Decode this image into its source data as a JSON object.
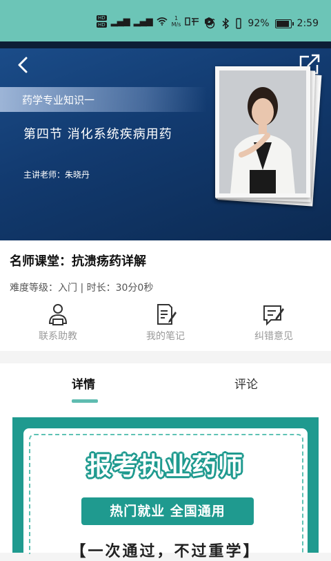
{
  "status_bar": {
    "hd1": "HD",
    "hd2": "HD",
    "signal1": "⁴ᴳ",
    "signal2": "⁴ᴳ",
    "speed_value": "1",
    "speed_unit": "M/s",
    "battery_percent": "92%",
    "battery_level": 0.92,
    "time": "2:59"
  },
  "banner": {
    "subject_tag": "药学专业知识一",
    "lesson_title": "第四节 消化系统疾病用药",
    "teacher": "主讲老师：朱晓丹"
  },
  "course": {
    "title": "名师课堂：抗溃疡药详解",
    "meta": "难度等级：入门 | 时长：30分0秒"
  },
  "actions": [
    {
      "label": "联系助教",
      "icon": "assistant-icon"
    },
    {
      "label": "我的笔记",
      "icon": "notes-icon"
    },
    {
      "label": "纠错意见",
      "icon": "feedback-icon"
    }
  ],
  "tabs": [
    {
      "label": "详情",
      "active": true
    },
    {
      "label": "评论",
      "active": false
    }
  ],
  "promo": {
    "headline": "报考执业药师",
    "pill": "热门就业  全国通用",
    "bottom": "【一次通过，不过重学】"
  },
  "colors": {
    "accent": "#5fbcb0",
    "status_bar": "#6cc5b7",
    "promo_teal": "#1f9a8f",
    "banner_blue": "#123a6f"
  }
}
